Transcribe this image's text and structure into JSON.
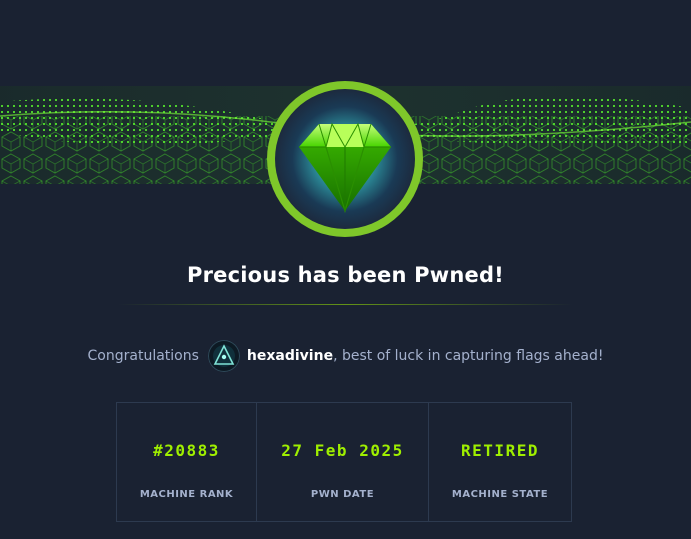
{
  "header": {
    "title": "Precious has been Pwned!"
  },
  "congratulations": {
    "prefix": "Congratulations",
    "username": "hexadivine",
    "suffix": ", best of luck in capturing flags ahead!"
  },
  "stats": [
    {
      "value": "#20883",
      "label": "MACHINE RANK"
    },
    {
      "value": "27 Feb 2025",
      "label": "PWN DATE"
    },
    {
      "value": "RETIRED",
      "label": "MACHINE STATE"
    }
  ],
  "icons": {
    "badge": "emerald-gem-icon",
    "avatar": "user-avatar"
  },
  "colors": {
    "background": "#1a2232",
    "accent_green": "#9fef00",
    "muted_text": "#a4b1cd",
    "border": "#2d3a4f"
  }
}
